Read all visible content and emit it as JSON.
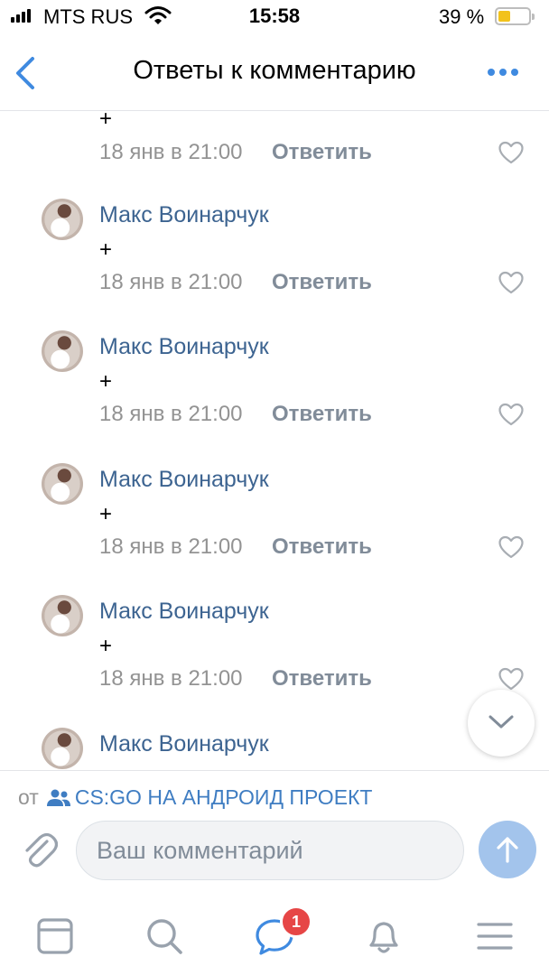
{
  "status_bar": {
    "carrier": "MTS RUS",
    "time": "15:58",
    "battery": "39 %"
  },
  "header": {
    "title": "Ответы к комментарию",
    "back_icon": "chevron-left-icon",
    "more_icon": "more-horizontal-icon"
  },
  "partial_comment": {
    "text": "+",
    "date": "18 янв в 21:00",
    "reply": "Ответить"
  },
  "comments": [
    {
      "author": "Макс Воинарчук",
      "text": "+",
      "date": "18 янв в 21:00",
      "reply": "Ответить"
    },
    {
      "author": "Макс Воинарчук",
      "text": "+",
      "date": "18 янв в 21:00",
      "reply": "Ответить"
    },
    {
      "author": "Макс Воинарчук",
      "text": "+",
      "date": "18 янв в 21:00",
      "reply": "Ответить"
    },
    {
      "author": "Макс Воинарчук",
      "text": "+",
      "date": "18 янв в 21:00",
      "reply": "Ответить"
    },
    {
      "author": "Макс Воинарчук"
    }
  ],
  "source": {
    "prefix": "от",
    "group": "CS:GO НА АНДРОИД ПРОЕКТ"
  },
  "composer": {
    "placeholder": "Ваш комментарий"
  },
  "tabbar": {
    "messages_badge": "1"
  },
  "colors": {
    "accent": "#3f8ae0",
    "author": "#3d6491",
    "badge": "#e64646"
  }
}
